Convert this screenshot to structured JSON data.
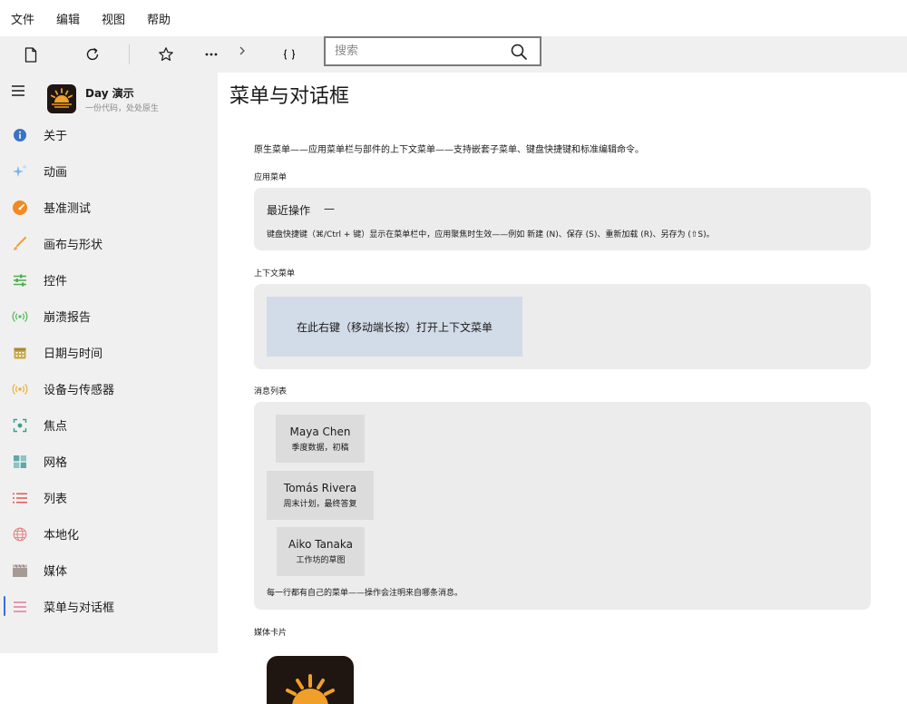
{
  "menubar": {
    "items": [
      "文件",
      "编辑",
      "视图",
      "帮助"
    ]
  },
  "search": {
    "placeholder": "搜索"
  },
  "brand": {
    "name": "Day 演示",
    "tagline": "一份代码，处处原生"
  },
  "sidebar": {
    "items": [
      {
        "label": "关于",
        "icon": "info-icon",
        "color": "#3a72c4"
      },
      {
        "label": "动画",
        "icon": "sparkle-icon",
        "color": "#79b6f0"
      },
      {
        "label": "基准测试",
        "icon": "gauge-icon",
        "color": "#f08a24"
      },
      {
        "label": "画布与形状",
        "icon": "brush-icon",
        "color": "#f2a03d"
      },
      {
        "label": "控件",
        "icon": "sliders-icon",
        "color": "#4cae4f"
      },
      {
        "label": "崩溃报告",
        "icon": "broadcast-icon",
        "color": "#58b85c"
      },
      {
        "label": "日期与时间",
        "icon": "calendar-icon",
        "color": "#c8a84a"
      },
      {
        "label": "设备与传感器",
        "icon": "sensor-icon",
        "color": "#e8b53a"
      },
      {
        "label": "焦点",
        "icon": "focus-icon",
        "color": "#3f9e8f"
      },
      {
        "label": "网格",
        "icon": "grid-icon",
        "color": "#5fa8a8"
      },
      {
        "label": "列表",
        "icon": "list-icon",
        "color": "#e05a5a"
      },
      {
        "label": "本地化",
        "icon": "globe-icon",
        "color": "#e08a8a"
      },
      {
        "label": "媒体",
        "icon": "clapper-icon",
        "color": "#a59a96"
      },
      {
        "label": "菜单与对话框",
        "icon": "menu-icon",
        "color": "#e07aa0"
      }
    ],
    "active_index": 13
  },
  "main": {
    "title": "菜单与对话框",
    "intro": "原生菜单——应用菜单栏与部件的上下文菜单——支持嵌套子菜单、键盘快捷键和标准编辑命令。",
    "app_menu": {
      "label": "应用菜单",
      "recent_label": "最近操作",
      "recent_value": "—",
      "note": "键盘快捷键（⌘/Ctrl + 键）显示在菜单栏中，应用聚焦时生效——例如 新建 (N)、保存 (S)、重新加载 (R)、另存为 (⇧S)。"
    },
    "context_menu": {
      "label": "上下文菜单",
      "target": "在此右键（移动端长按）打开上下文菜单"
    },
    "messages": {
      "label": "消息列表",
      "items": [
        {
          "name": "Maya Chen",
          "subject": "季度数据，初稿"
        },
        {
          "name": "Tomás Rivera",
          "subject": "周末计划，最终答复"
        },
        {
          "name": "Aiko Tanaka",
          "subject": "工作坊的草图"
        }
      ],
      "footer": "每一行都有自己的菜单——操作会注明来自哪条消息。"
    },
    "media": {
      "label": "媒体卡片"
    }
  },
  "colors": {
    "sidebar_bg": "#f0f0f0",
    "card_bg": "#ececec",
    "context_target_bg": "#d2dbe8",
    "accent": "#3b6fd6",
    "logo_bg": "#1f1511",
    "logo_sun": "#f0a028"
  }
}
